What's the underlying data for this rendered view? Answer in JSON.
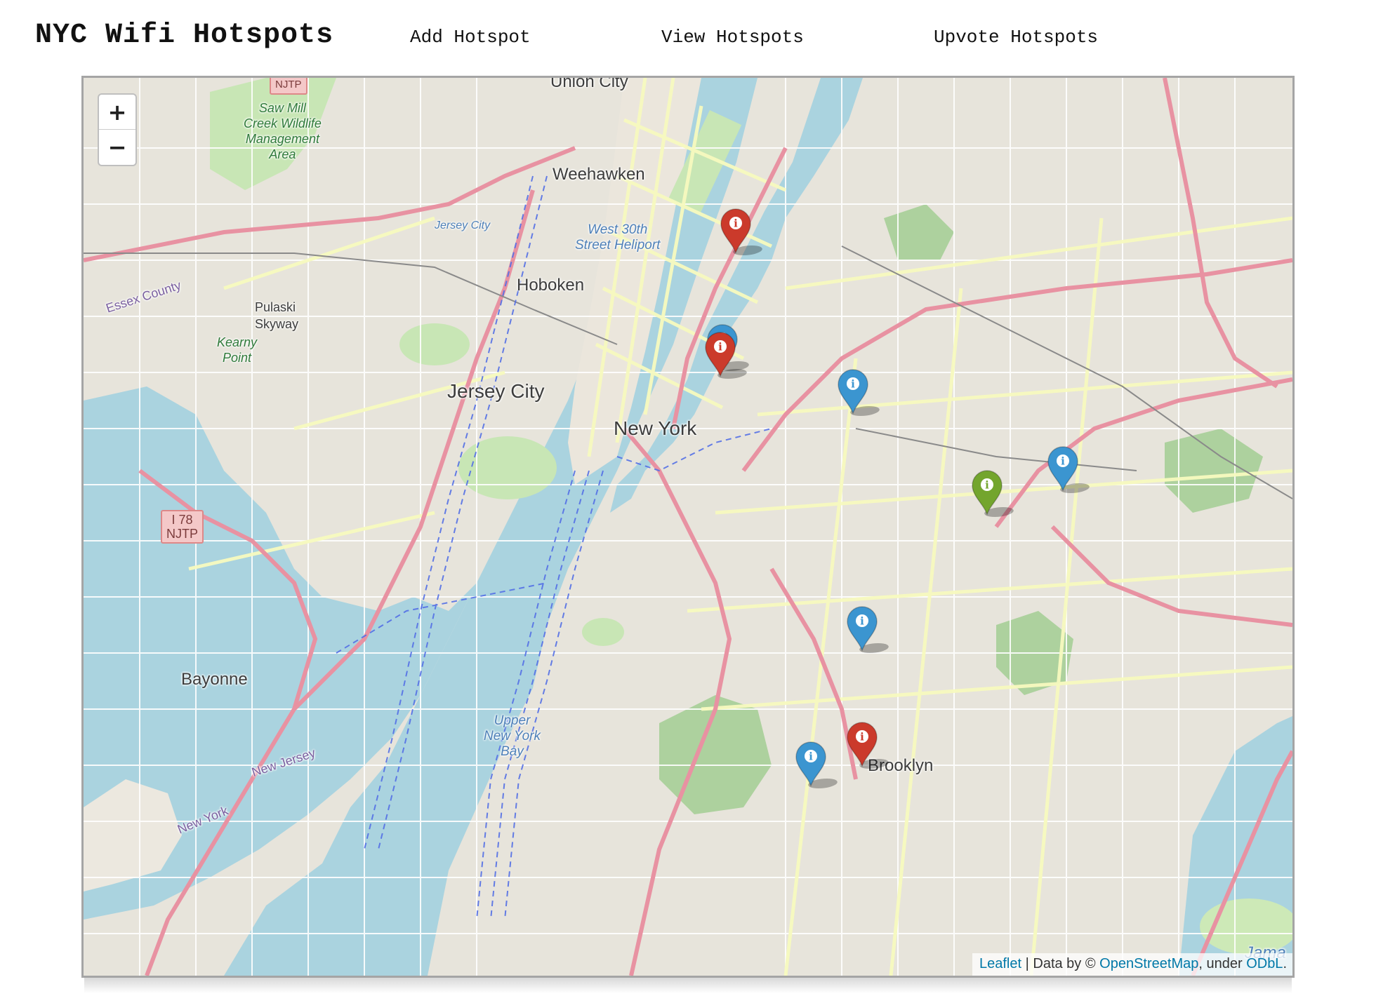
{
  "header": {
    "title": "NYC Wifi Hotspots",
    "nav": [
      "Add Hotspot",
      "View Hotspots",
      "Upvote Hotspots"
    ]
  },
  "map": {
    "zoom_in_label": "+",
    "zoom_out_label": "−",
    "attribution": {
      "leaflet": "Leaflet",
      "sep": " | Data by © ",
      "osm": "OpenStreetMap",
      "under": ", under ",
      "odbl": "ODbL",
      "end": "."
    },
    "labels": {
      "new_york": "New York",
      "jersey_city": "Jersey City",
      "hoboken": "Hoboken",
      "weehawken": "Weehawken",
      "union_city": "Union City",
      "bayonne": "Bayonne",
      "brooklyn": "Brooklyn",
      "new_jersey": "New Jersey",
      "new_york_state": "New York",
      "pulaski": "Pulaski\nSkyway",
      "kearny": "Kearny\nPoint",
      "upper_bay": "Upper\nNew York\nBay",
      "heliport": "West 30th\nStreet Heliport",
      "saw_mill": "Saw Mill\nCreek Wildlife\nManagement\nArea",
      "jersey_city_small": "Jersey City",
      "essex": "Essex County",
      "jamaica": "Jama",
      "i78": "I 78\nNJTP",
      "njtp": "NJTP"
    },
    "marker_colors": {
      "red": "#cb3a2b",
      "blue": "#3b95d0",
      "green": "#73a52d"
    },
    "marker_icon": "info-icon",
    "markers": [
      {
        "color": "red"
      },
      {
        "color": "blue"
      },
      {
        "color": "red"
      },
      {
        "color": "blue"
      },
      {
        "color": "green"
      },
      {
        "color": "blue"
      },
      {
        "color": "blue"
      },
      {
        "color": "red"
      },
      {
        "color": "blue"
      }
    ]
  }
}
